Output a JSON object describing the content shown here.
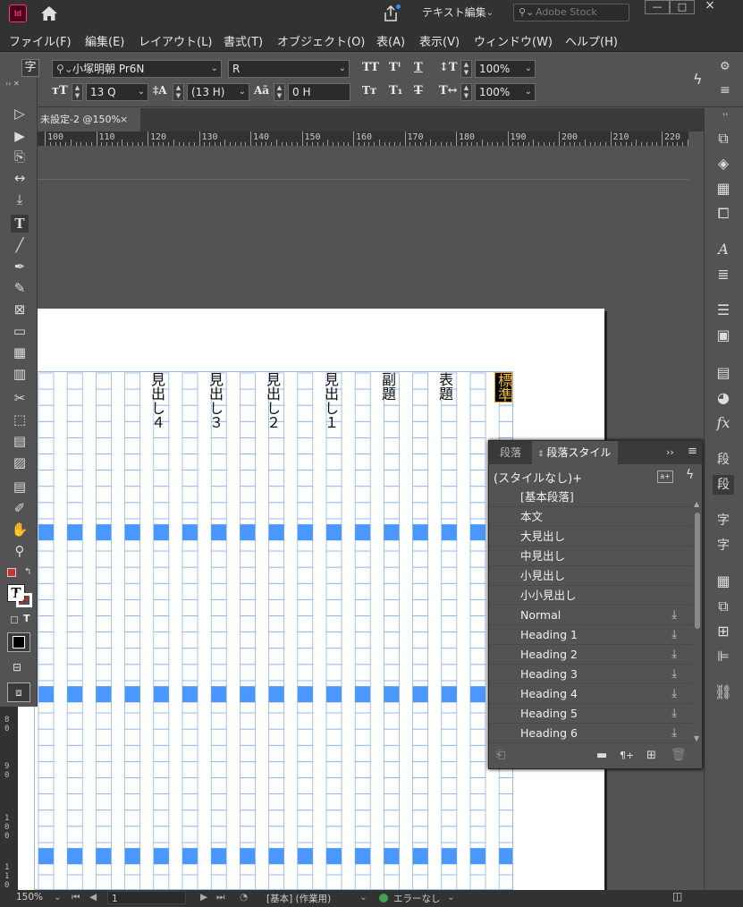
{
  "titlebar": {
    "app_icon": "Id",
    "home_icon": "home-icon",
    "share_icon": "share-icon",
    "workspace": "テキスト編集",
    "search_placeholder": "Adobe Stock",
    "win_min": "—",
    "win_max": "□",
    "win_close": "×"
  },
  "menu": [
    "ファイル(F)",
    "編集(E)",
    "レイアウト(L)",
    "書式(T)",
    "オブジェクト(O)",
    "表(A)",
    "表示(V)",
    "ウィンドウ(W)",
    "ヘルプ(H)"
  ],
  "control": {
    "char_mode": "字",
    "font_family": "小塚明朝 Pr6N",
    "font_style": "R",
    "font_size": "13 Q",
    "leading": "(13 H)",
    "tracking": "0 H",
    "vscale": "100%",
    "hscale": "100%"
  },
  "document": {
    "tab_title": "未設定-2 @150%",
    "tab_close": "×"
  },
  "ruler": {
    "labels": [
      "100",
      "110",
      "120",
      "130",
      "140",
      "150",
      "160",
      "170",
      "180",
      "190",
      "200",
      "210",
      "220"
    ],
    "vlabels": [
      "8 0",
      "9 0",
      "1 0 0",
      "1 1 0"
    ]
  },
  "page_text": [
    "見出し４",
    "見出し３",
    "見出し２",
    "見出し１",
    "副題",
    "表題",
    "標準"
  ],
  "paragraph_panel": {
    "tab_inactive": "段落",
    "tab_active": "段落スタイル",
    "current_style": "(スタイルなし)+",
    "styles": [
      {
        "label": "[基本段落]",
        "imported": false
      },
      {
        "label": "本文",
        "imported": false
      },
      {
        "label": "大見出し",
        "imported": false
      },
      {
        "label": "中見出し",
        "imported": false
      },
      {
        "label": "小見出し",
        "imported": false
      },
      {
        "label": "小小見出し",
        "imported": false
      },
      {
        "label": "Normal",
        "imported": true
      },
      {
        "label": "Heading 1",
        "imported": true
      },
      {
        "label": "Heading 2",
        "imported": true
      },
      {
        "label": "Heading 3",
        "imported": true
      },
      {
        "label": "Heading 4",
        "imported": true
      },
      {
        "label": "Heading 5",
        "imported": true
      },
      {
        "label": "Heading 6",
        "imported": true
      }
    ],
    "footer_pilcrow": "¶+"
  },
  "right_panel": {
    "char_label": "字",
    "para_label": "段",
    "para_style_label": "段",
    "char_style_label": "字",
    "char_style2_label": "字"
  },
  "tools": {
    "fill_label": "T",
    "frame_text_label": "T"
  },
  "status": {
    "zoom": "150%",
    "page": "1",
    "master": "[基本] (作業用)",
    "preflight": "エラーなし"
  },
  "colors": {
    "accent": "#4a98ff",
    "grid_line": "#8fb3e8",
    "preflight_ok": "#3fa34d"
  }
}
